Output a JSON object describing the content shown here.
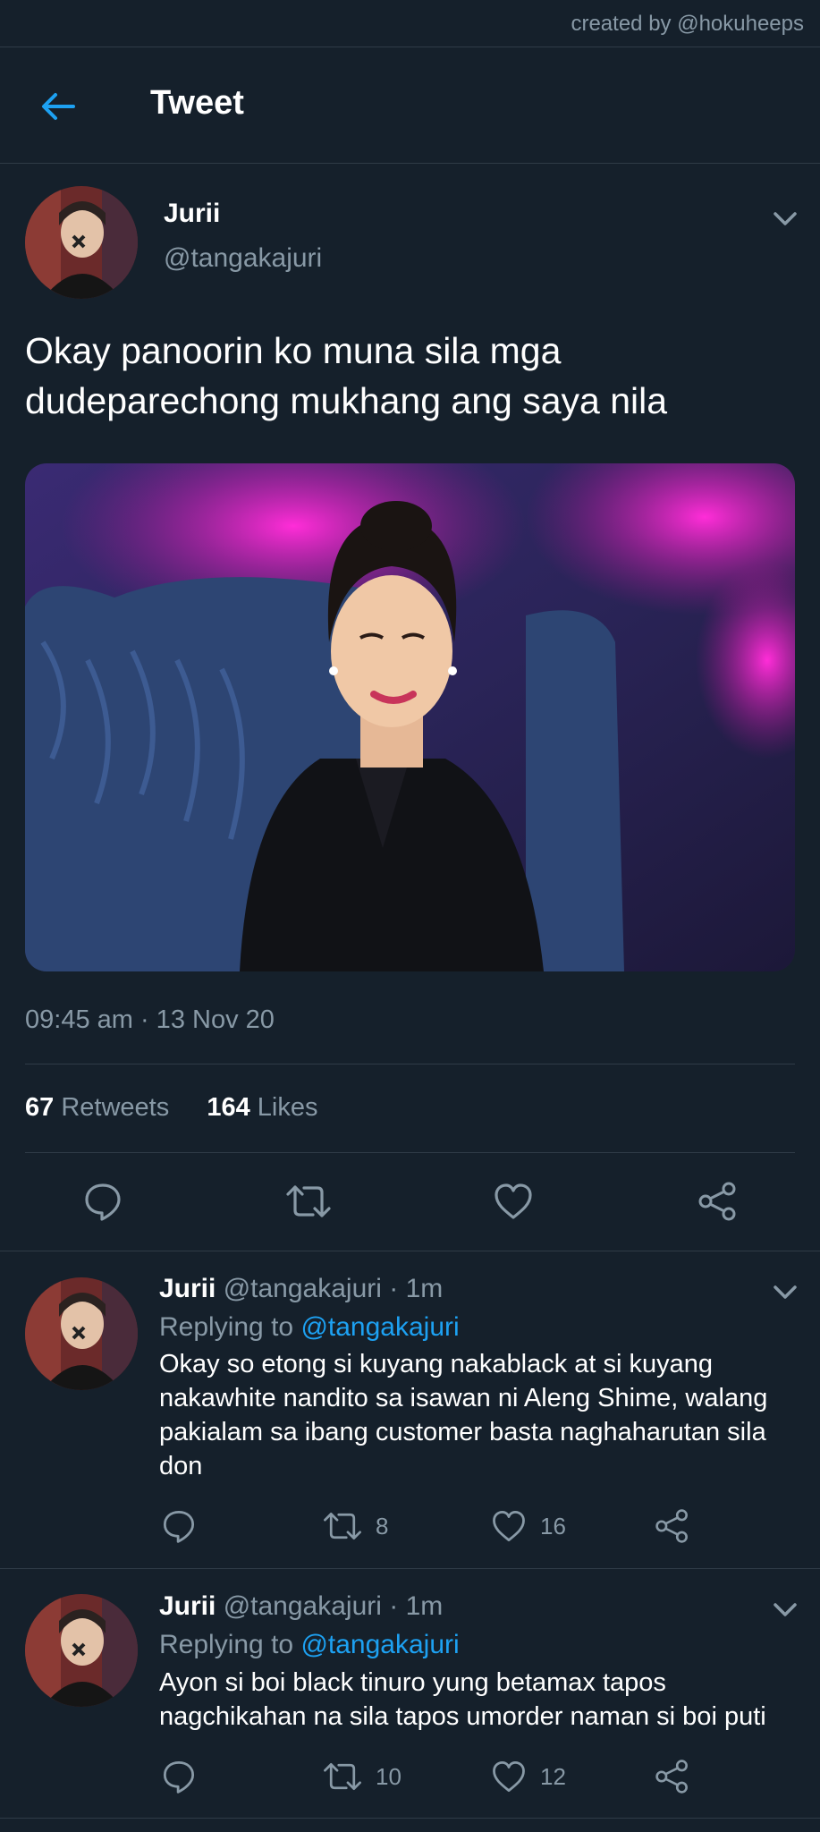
{
  "credit": "created by @hokuheeps",
  "header": {
    "title": "Tweet"
  },
  "tweet": {
    "name": "Jurii",
    "handle": "@tangakajuri",
    "text": "Okay panoorin ko muna sila mga dudeparechong mukhang ang saya nila",
    "timestamp": "09:45 am · 13 Nov 20",
    "retweets_count": "67",
    "retweets_label": "Retweets",
    "likes_count": "164",
    "likes_label": "Likes"
  },
  "replies": [
    {
      "name": "Jurii",
      "handle_time": "@tangakajuri · 1m",
      "replying_prefix": "Replying to",
      "replying_to": "@tangakajuri",
      "text": "Okay so etong si kuyang nakablack at si kuyang nakawhite nandito sa isawan ni Aleng Shime, walang pakialam sa ibang customer basta naghaharutan sila don",
      "retweets": "8",
      "likes": "16"
    },
    {
      "name": "Jurii",
      "handle_time": "@tangakajuri · 1m",
      "replying_prefix": "Replying to",
      "replying_to": "@tangakajuri",
      "text": "Ayon si boi black tinuro yung betamax tapos nagchikahan na sila tapos umorder naman si boi puti",
      "retweets": "10",
      "likes": "12"
    }
  ],
  "colors": {
    "background": "#15202b",
    "accent": "#1da1f2",
    "secondary_text": "#8899a6",
    "divider": "#2f3b47"
  }
}
